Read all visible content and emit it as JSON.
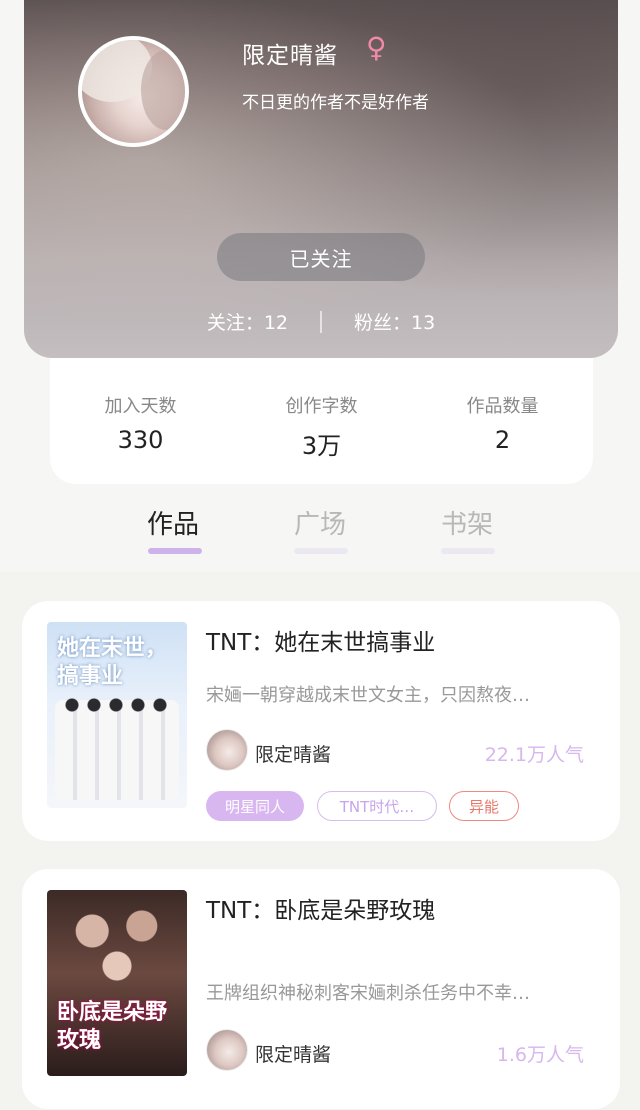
{
  "profile": {
    "name": "限定晴酱",
    "gender_icon": "female-symbol-icon",
    "gender_glyph": "♀",
    "signature": "不日更的作者不是好作者",
    "follow_button": "已关注",
    "following": "关注：12",
    "followers": "粉丝：13"
  },
  "info": [
    {
      "label": "加入天数",
      "value": "330"
    },
    {
      "label": "创作字数",
      "value": "3万"
    },
    {
      "label": "作品数量",
      "value": "2"
    }
  ],
  "tabs": [
    {
      "label": "作品",
      "active": true
    },
    {
      "label": "广场",
      "active": false
    },
    {
      "label": "书架",
      "active": false
    }
  ],
  "books": [
    {
      "cover_text": "她在末世，搞事业",
      "title": "TNT：她在末世搞事业",
      "description": "宋婳一朝穿越成末世文女主，只因熬夜…",
      "author": "限定晴酱",
      "popularity": "22.1万人气",
      "tags": [
        "明星同人",
        "TNT时代…",
        "异能"
      ]
    },
    {
      "cover_text": "卧底是朵野玫瑰",
      "title": "TNT：卧底是朵野玫瑰",
      "description": "王牌组织神秘刺客宋婳刺杀任务中不幸…",
      "author": "限定晴酱",
      "popularity": "1.6万人气"
    }
  ],
  "colors": {
    "accent": "#cdb3ea",
    "popularity": "#d7b7ec",
    "tag_red": "#e9776b",
    "gender": "#f08aa7"
  }
}
